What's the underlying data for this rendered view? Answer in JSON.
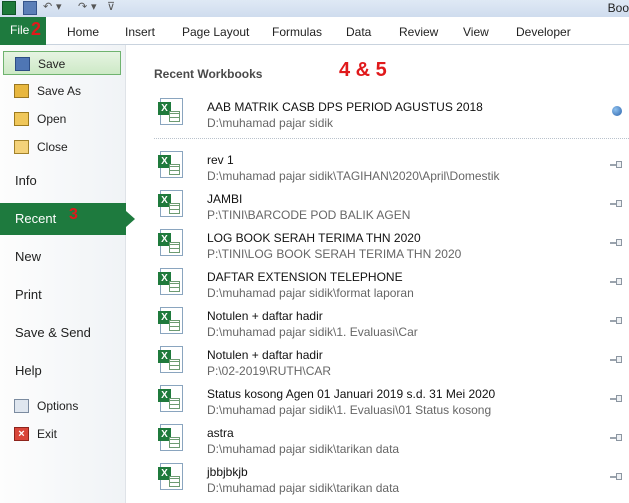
{
  "title_bar": {
    "text": "Boo"
  },
  "ribbon": {
    "file_label": "File",
    "file_badge": "2",
    "tabs": [
      "Home",
      "Insert",
      "Page Layout",
      "Formulas",
      "Data",
      "Review",
      "View",
      "Developer"
    ]
  },
  "nav": {
    "save": "Save",
    "save_as": "Save As",
    "open": "Open",
    "close": "Close",
    "info": "Info",
    "recent": "Recent",
    "recent_badge": "3",
    "new": "New",
    "print": "Print",
    "save_send": "Save & Send",
    "help": "Help",
    "options": "Options",
    "exit": "Exit"
  },
  "main": {
    "section_title": "Recent Workbooks",
    "step_badge": "4 & 5",
    "workbooks": [
      {
        "name": "AAB MATRIK CASB DPS PERIOD AGUSTUS 2018",
        "path": "D:\\muhamad pajar sidik",
        "pinned": true
      },
      {
        "name": "rev 1",
        "path": "D:\\muhamad pajar sidik\\TAGIHAN\\2020\\April\\Domestik",
        "pinned": false
      },
      {
        "name": "JAMBI",
        "path": "P:\\TINI\\BARCODE POD BALIK AGEN",
        "pinned": false
      },
      {
        "name": "LOG BOOK SERAH TERIMA THN 2020",
        "path": "P:\\TINI\\LOG BOOK SERAH TERIMA THN 2020",
        "pinned": false
      },
      {
        "name": "DAFTAR EXTENSION TELEPHONE",
        "path": "D:\\muhamad pajar sidik\\format laporan",
        "pinned": false
      },
      {
        "name": "Notulen + daftar hadir",
        "path": "D:\\muhamad pajar sidik\\1. Evaluasi\\Car",
        "pinned": false
      },
      {
        "name": "Notulen + daftar hadir",
        "path": "P:\\02-2019\\RUTH\\CAR",
        "pinned": false
      },
      {
        "name": "Status kosong Agen 01 Januari 2019 s.d. 31 Mei 2020",
        "path": "D:\\muhamad pajar sidik\\1. Evaluasi\\01 Status kosong",
        "pinned": false
      },
      {
        "name": "astra",
        "path": "D:\\muhamad pajar sidik\\tarikan data",
        "pinned": false
      },
      {
        "name": "jbbjbkjb",
        "path": "D:\\muhamad pajar sidik\\tarikan data",
        "pinned": false
      }
    ]
  },
  "colors": {
    "accent_green": "#1e7a3e",
    "annotation_red": "#e0191b"
  }
}
